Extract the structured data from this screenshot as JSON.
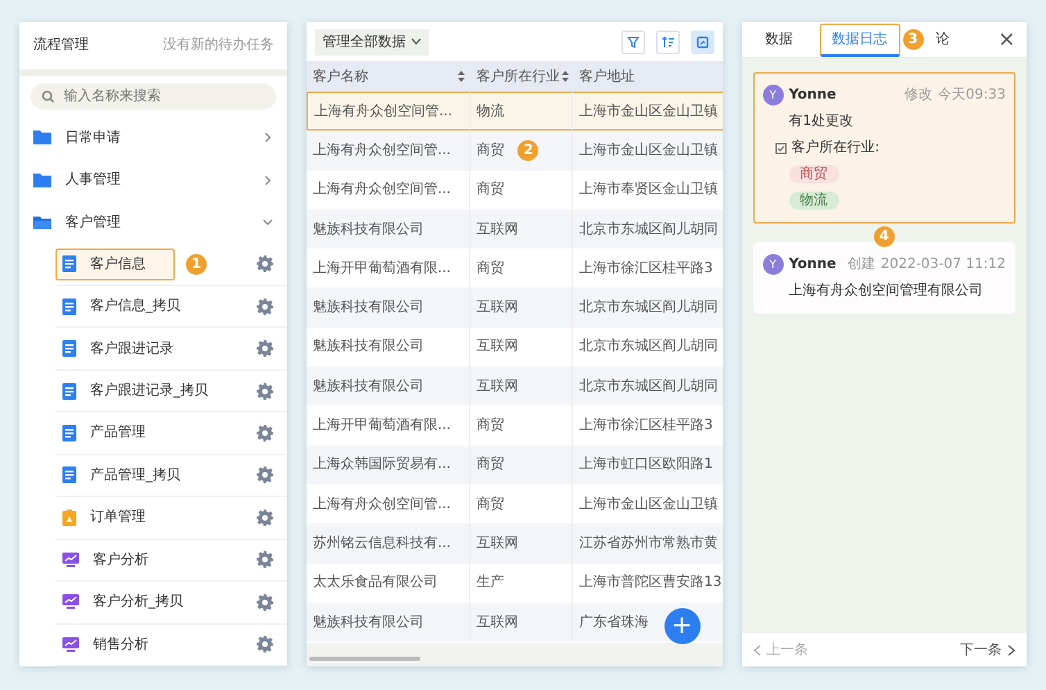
{
  "flow_panel": {
    "title": "流程管理",
    "notice": "没有新的待办任务",
    "search": {
      "placeholder": "输入名称来搜索"
    },
    "folders": [
      {
        "label": "日常申请",
        "expanded": false
      },
      {
        "label": "人事管理",
        "expanded": false
      },
      {
        "label": "客户管理",
        "expanded": true,
        "children": [
          {
            "label": "客户信息",
            "kind": "form",
            "highlighted": true,
            "badge": "1"
          },
          {
            "label": "客户信息_拷贝",
            "kind": "form",
            "highlighted": false
          },
          {
            "label": "客户跟进记录",
            "kind": "form",
            "highlighted": false
          },
          {
            "label": "客户跟进记录_拷贝",
            "kind": "form",
            "highlighted": false
          },
          {
            "label": "产品管理",
            "kind": "form",
            "highlighted": false
          },
          {
            "label": "产品管理_拷贝",
            "kind": "form",
            "highlighted": false
          },
          {
            "label": "订单管理",
            "kind": "order",
            "highlighted": false
          },
          {
            "label": "客户分析",
            "kind": "report",
            "highlighted": false
          },
          {
            "label": "客户分析_拷贝",
            "kind": "report",
            "highlighted": false
          },
          {
            "label": "销售分析",
            "kind": "report",
            "highlighted": false
          }
        ]
      }
    ]
  },
  "table_panel": {
    "scope_dropdown": "管理全部数据",
    "tools": [
      {
        "kind": "filter",
        "selected": false
      },
      {
        "kind": "sort",
        "selected": false
      },
      {
        "kind": "view",
        "selected": true
      }
    ],
    "columns": [
      {
        "label": "客户名称",
        "sortable": true
      },
      {
        "label": "客户所在行业",
        "sortable": true
      },
      {
        "label": "客户地址",
        "sortable": false
      }
    ],
    "rows": [
      {
        "cells": [
          "上海有舟众创空间管...",
          "物流",
          "上海市金山区金山卫镇"
        ],
        "highlighted": true
      },
      {
        "cells": [
          "上海有舟众创空间管...",
          "商贸",
          "上海市金山区金山卫镇"
        ],
        "highlighted": false,
        "badge": "2"
      },
      {
        "cells": [
          "上海有舟众创空间管...",
          "商贸",
          "上海市奉贤区金山卫镇"
        ],
        "highlighted": false
      },
      {
        "cells": [
          "魅族科技有限公司",
          "互联网",
          "北京市东城区阎儿胡同"
        ],
        "highlighted": false
      },
      {
        "cells": [
          "上海开甲葡萄酒有限...",
          "商贸",
          "上海市徐汇区桂平路3"
        ],
        "highlighted": false
      },
      {
        "cells": [
          "魅族科技有限公司",
          "互联网",
          "北京市东城区阎儿胡同"
        ],
        "highlighted": false
      },
      {
        "cells": [
          "魅族科技有限公司",
          "互联网",
          "北京市东城区阎儿胡同"
        ],
        "highlighted": false
      },
      {
        "cells": [
          "魅族科技有限公司",
          "互联网",
          "北京市东城区阎儿胡同"
        ],
        "highlighted": false
      },
      {
        "cells": [
          "上海开甲葡萄酒有限...",
          "商贸",
          "上海市徐汇区桂平路3"
        ],
        "highlighted": false
      },
      {
        "cells": [
          "上海众韩国际贸易有...",
          "商贸",
          "上海市虹口区欧阳路1"
        ],
        "highlighted": false
      },
      {
        "cells": [
          "上海有舟众创空间管...",
          "商贸",
          "上海市金山区金山卫镇"
        ],
        "highlighted": false
      },
      {
        "cells": [
          "苏州铭云信息科技有...",
          "互联网",
          "江苏省苏州市常熟市黄"
        ],
        "highlighted": false
      },
      {
        "cells": [
          "太太乐食品有限公司",
          "生产",
          "上海市普陀区曹安路13"
        ],
        "highlighted": false
      },
      {
        "cells": [
          "魅族科技有限公司",
          "互联网",
          "广东省珠海"
        ],
        "highlighted": false
      }
    ],
    "add_button": "+"
  },
  "log_panel": {
    "tabs": [
      {
        "label": "数据",
        "selected": false,
        "highlighted": false
      },
      {
        "label": "数据日志",
        "selected": true,
        "highlighted": true,
        "badge": "3"
      },
      {
        "label": "论",
        "selected": false,
        "highlighted": false
      }
    ],
    "close": "×",
    "entries": [
      {
        "avatar": "Y",
        "user": "Yonne",
        "action": "修改",
        "time": "今天09:33",
        "highlighted": true,
        "summary": "有1处更改",
        "field": "客户所在行业:",
        "old_value": "商贸",
        "new_value": "物流"
      },
      {
        "avatar": "Y",
        "user": "Yonne",
        "action": "创建",
        "time": "2022-03-07 11:12",
        "highlighted": false,
        "badge": "4",
        "text": "上海有舟众创空间管理有限公司"
      }
    ],
    "prev": "上一条",
    "next": "下一条"
  }
}
